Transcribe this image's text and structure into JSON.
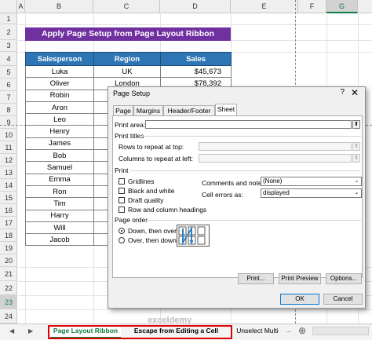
{
  "sheet": {
    "columns": [
      "A",
      "B",
      "C",
      "D",
      "E",
      "F",
      "G"
    ],
    "rows": [
      "1",
      "2",
      "3",
      "4",
      "5",
      "6",
      "7",
      "8",
      "9",
      "10",
      "11",
      "12",
      "13",
      "14",
      "15",
      "16",
      "17",
      "18",
      "19",
      "20",
      "21",
      "22",
      "23",
      "24"
    ],
    "selected_column": "G",
    "selected_row": "23",
    "title_box": "Apply Page Setup from Page Layout Ribbon",
    "table": {
      "headers": [
        "Salesperson",
        "Region",
        "Sales"
      ],
      "rows": [
        [
          "Luka",
          "UK",
          "$45,673"
        ],
        [
          "Oliver",
          "London",
          "$78,392"
        ],
        [
          "Robin",
          "",
          ""
        ],
        [
          "Aron",
          "",
          ""
        ],
        [
          "Leo",
          "",
          ""
        ],
        [
          "Henry",
          "",
          ""
        ],
        [
          "James",
          "",
          ""
        ],
        [
          "Bob",
          "",
          ""
        ],
        [
          "Samuel",
          "",
          ""
        ],
        [
          "Emma",
          "",
          ""
        ],
        [
          "Ron",
          "",
          ""
        ],
        [
          "Tim",
          "",
          ""
        ],
        [
          "Harry",
          "",
          ""
        ],
        [
          "Will",
          "",
          ""
        ],
        [
          "Jacob",
          "",
          ""
        ]
      ]
    },
    "colors": {
      "title_bg": "#7030a0",
      "header_bg": "#2e75b6",
      "accent": "#107c41"
    }
  },
  "dialog": {
    "title": "Page Setup",
    "help": "?",
    "close_icon": "close-icon",
    "tabs": [
      "Page",
      "Margins",
      "Header/Footer",
      "Sheet"
    ],
    "active_tab": "Sheet",
    "print_area_label": "Print area:",
    "print_titles_label": "Print titles",
    "rows_repeat_label": "Rows to repeat at top:",
    "cols_repeat_label": "Columns to repeat at left:",
    "print_label": "Print",
    "checkboxes": [
      {
        "label": "Gridlines",
        "checked": false
      },
      {
        "label": "Black and white",
        "checked": false
      },
      {
        "label": "Draft quality",
        "checked": false
      },
      {
        "label": "Row and column headings",
        "checked": false
      }
    ],
    "comments_label": "Comments and notes:",
    "comments_value": "(None)",
    "errors_label": "Cell errors as:",
    "errors_value": "displayed",
    "page_order_label": "Page order",
    "radio_down": "Down, then over",
    "radio_over": "Over, then down",
    "page_order_selected": "Down, then over",
    "buttons": {
      "print": "Print...",
      "preview": "Print Preview",
      "options": "Options...",
      "ok": "OK",
      "cancel": "Cancel"
    }
  },
  "tabbar": {
    "tabs": [
      "Page Layout Ribbon",
      "Escape from Editing a Cell",
      "Unselect Multi"
    ],
    "active_tab": "Page Layout Ribbon",
    "add_icon": "plus-icon",
    "more": "...",
    "watermark": "exceldemy"
  }
}
